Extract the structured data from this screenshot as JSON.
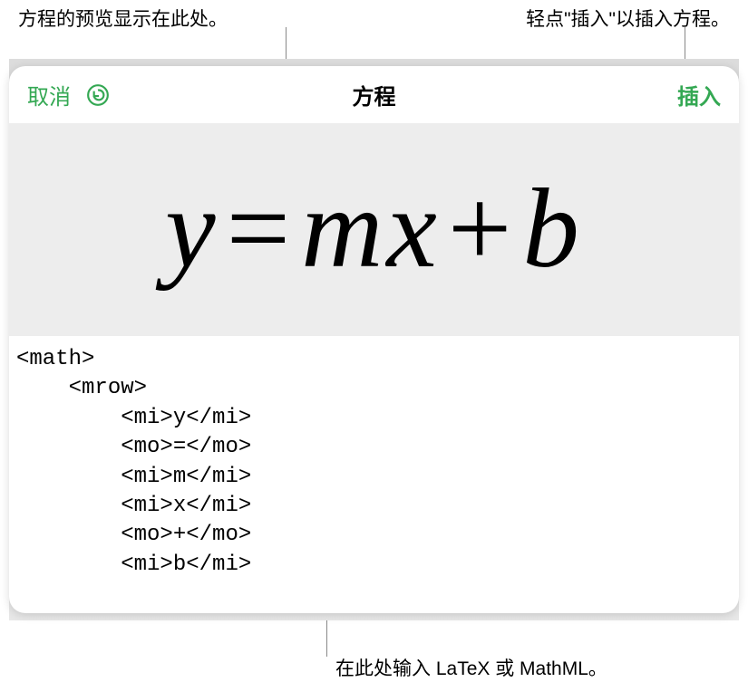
{
  "callouts": {
    "preview": "方程的预览显示在此处。",
    "insert": "轻点\"插入\"以插入方程。",
    "input": "在此处输入 LaTeX 或 MathML。"
  },
  "header": {
    "cancel": "取消",
    "title": "方程",
    "insert": "插入"
  },
  "equation": {
    "y": "y",
    "eq": "=",
    "m": "m",
    "x": "x",
    "plus": "+",
    "b": "b"
  },
  "code": {
    "line1": "<math>",
    "line2": "    <mrow>",
    "line3": "        <mi>y</mi>",
    "line4": "        <mo>=</mo>",
    "line5": "        <mi>m</mi>",
    "line6": "        <mi>x</mi>",
    "line7": "        <mo>+</mo>",
    "line8": "        <mi>b</mi>"
  }
}
